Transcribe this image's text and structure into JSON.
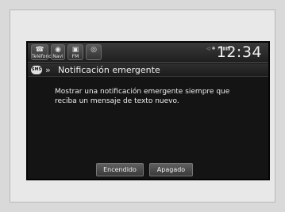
{
  "statusbar": {
    "buttons": [
      {
        "label": "Teléfono",
        "icon": "phone-icon",
        "glyph": "☎"
      },
      {
        "label": "Navi",
        "icon": "compass-icon",
        "glyph": "◉"
      },
      {
        "label": "FM",
        "icon": "radio-icon",
        "glyph": "▣"
      },
      {
        "label": "",
        "icon": "audio-source-icon",
        "glyph": "◎"
      }
    ],
    "indicators": "◁ ✱ ↗ ▮▮▮",
    "clock": "12:34"
  },
  "header": {
    "sms_badge": "SMS",
    "chevron": "»",
    "title": "Notificación emergente"
  },
  "main": {
    "message": "Mostrar una notificación emergente siempre que reciba un mensaje de texto nuevo."
  },
  "actions": {
    "on_label": "Encendido",
    "off_label": "Apagado"
  }
}
